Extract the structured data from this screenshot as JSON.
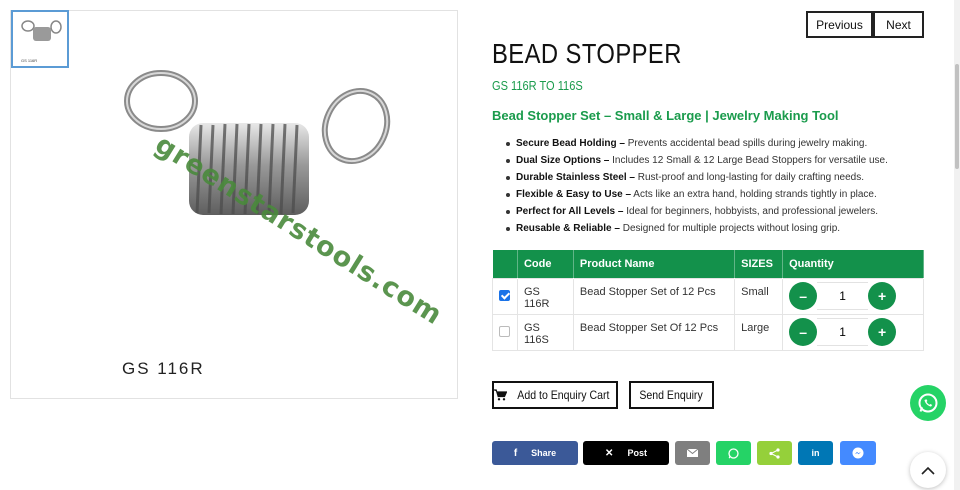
{
  "gallery": {
    "thumb_caption": "GS 116R",
    "image_caption": "GS 116R",
    "watermark": "greenstarstools.com"
  },
  "nav": {
    "previous": "Previous",
    "next": "Next"
  },
  "product": {
    "title": "BEAD STOPPER",
    "code_range": "GS 116R TO 116S",
    "subtitle": "Bead Stopper Set – Small & Large | Jewelry Making Tool",
    "features": [
      {
        "bold": "Secure Bead Holding –",
        "text": " Prevents accidental bead spills during jewelry making."
      },
      {
        "bold": "Dual Size Options –",
        "text": " Includes 12 Small & 12 Large Bead Stoppers for versatile use."
      },
      {
        "bold": "Durable Stainless Steel –",
        "text": " Rust-proof and long-lasting for daily crafting needs."
      },
      {
        "bold": "Flexible & Easy to Use –",
        "text": " Acts like an extra hand, holding strands tightly in place."
      },
      {
        "bold": "Perfect for All Levels –",
        "text": " Ideal for beginners, hobbyists, and professional jewelers."
      },
      {
        "bold": "Reusable & Reliable –",
        "text": " Designed for multiple projects without losing grip."
      }
    ]
  },
  "table": {
    "headers": [
      "Code",
      "Product Name",
      "SIZES",
      "Quantity"
    ],
    "rows": [
      {
        "checked": true,
        "code": "GS 116R",
        "name": "Bead Stopper Set of 12 Pcs",
        "size": "Small",
        "qty": "1"
      },
      {
        "checked": false,
        "code": "GS 116S",
        "name": "Bead Stopper Set Of 12 Pcs",
        "size": "Large",
        "qty": "1"
      }
    ],
    "minus": "–",
    "plus": "+"
  },
  "actions": {
    "add_to_cart": "Add to Enquiry Cart",
    "send_enquiry": "Send Enquiry"
  },
  "share": {
    "facebook": "Share",
    "x": "Post",
    "colors": {
      "facebook": "#3b5998",
      "x": "#000000",
      "email": "#7f7f7f",
      "whatsapp": "#25d366",
      "sharethis": "#95d03a",
      "linkedin": "#0077b5",
      "messenger": "#448aff"
    }
  },
  "colors": {
    "accent": "#13914b",
    "checkbox": "#1a73e8"
  }
}
